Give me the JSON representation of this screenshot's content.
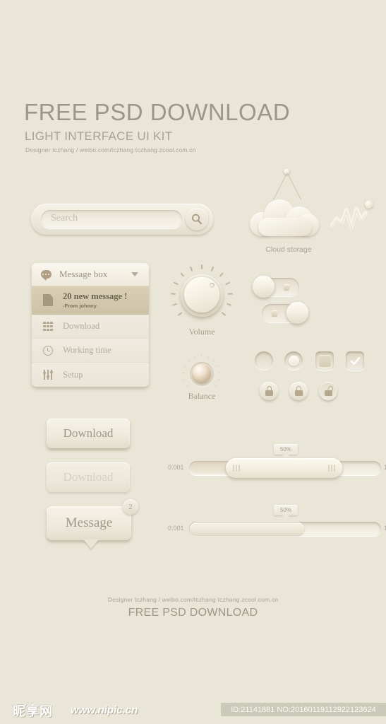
{
  "header": {
    "title": "FREE PSD DOWNLOAD",
    "subtitle": "LIGHT INTERFACE UI KIT",
    "credit": "Designer  tczhang  /  weibo.com/tczhang    tczhang.zcool.com.cn"
  },
  "search": {
    "placeholder": "Search",
    "icon": "search-icon"
  },
  "cloud": {
    "label": "Cloud storage",
    "icon": "cloud-icon",
    "wave_icon": "waveform-icon"
  },
  "menu": {
    "header_label": "Message box",
    "header_icon": "chat-bubble-icon",
    "caret_icon": "chevron-down-icon",
    "items": [
      {
        "label": "20 new message !",
        "sub": "-From johnny",
        "icon": "document-icon",
        "active": true
      },
      {
        "label": "Download",
        "icon": "grid-icon",
        "active": false
      },
      {
        "label": "Working time",
        "icon": "clock-icon",
        "active": false
      },
      {
        "label": "Setup",
        "icon": "sliders-icon",
        "active": false
      }
    ]
  },
  "knobs": {
    "volume_label": "Volume",
    "balance_label": "Balance"
  },
  "toggles": {
    "off_state": "off",
    "on_state": "on"
  },
  "controls": {
    "radio_empty": "radio-unselected",
    "radio_checked": "radio-selected",
    "checkbox_empty": "checkbox-unchecked",
    "checkbox_checked": "checkbox-checked",
    "lock_closed_1": "lock-closed-icon",
    "lock_closed_2": "lock-closed-icon",
    "lock_open": "lock-open-icon"
  },
  "buttons": {
    "download_primary": "Download",
    "download_disabled": "Download",
    "message": "Message",
    "message_badge": "2"
  },
  "sliders": [
    {
      "min": "0.001",
      "max": "1",
      "tooltip": "50%",
      "value": 50,
      "type": "range"
    },
    {
      "min": "0.001",
      "max": "1",
      "tooltip": "50%",
      "value": 50,
      "type": "progress"
    }
  ],
  "footer": {
    "credit": "Designer  tczhang  /  weibo.com/tczhang    tczhang.zcool.com.cn",
    "title": "FREE PSD DOWNLOAD"
  },
  "watermark": {
    "logo": "昵享网",
    "url": "www.nipic.cn",
    "id": "ID:21141881 NO:20160119112922123624"
  },
  "colors": {
    "background": "#e9e6d7",
    "surface": "#efeade",
    "text": "#a09884",
    "accent": "#b09f85",
    "active_row": "#d2c9ae"
  }
}
